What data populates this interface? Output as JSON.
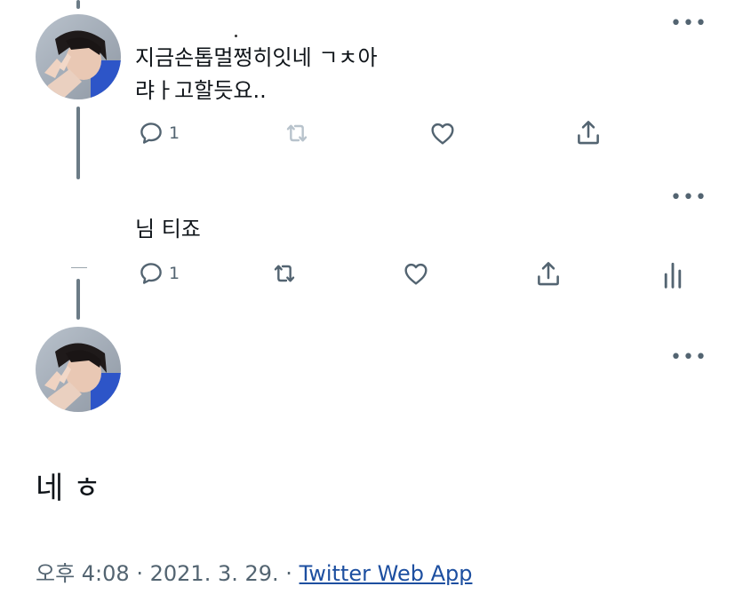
{
  "reply1": {
    "text_line1": "지금손톱멀쩡히잇네 ㄱㅊ아",
    "text_line2": "랴ㅏ고할듯요..",
    "reply_count": "1"
  },
  "reply2": {
    "text": "님 티죠",
    "reply_count": "1"
  },
  "main_tweet": {
    "text": "네 ㅎ",
    "time": "오후 4:08",
    "separator": "·",
    "date": "2021. 3. 29.",
    "source": "Twitter Web App"
  },
  "icons": {
    "more": "more-horizontal-icon",
    "reply": "reply-bubble-icon",
    "retweet": "retweet-icon",
    "like": "heart-icon",
    "share": "share-icon",
    "analytics": "analytics-icon"
  }
}
